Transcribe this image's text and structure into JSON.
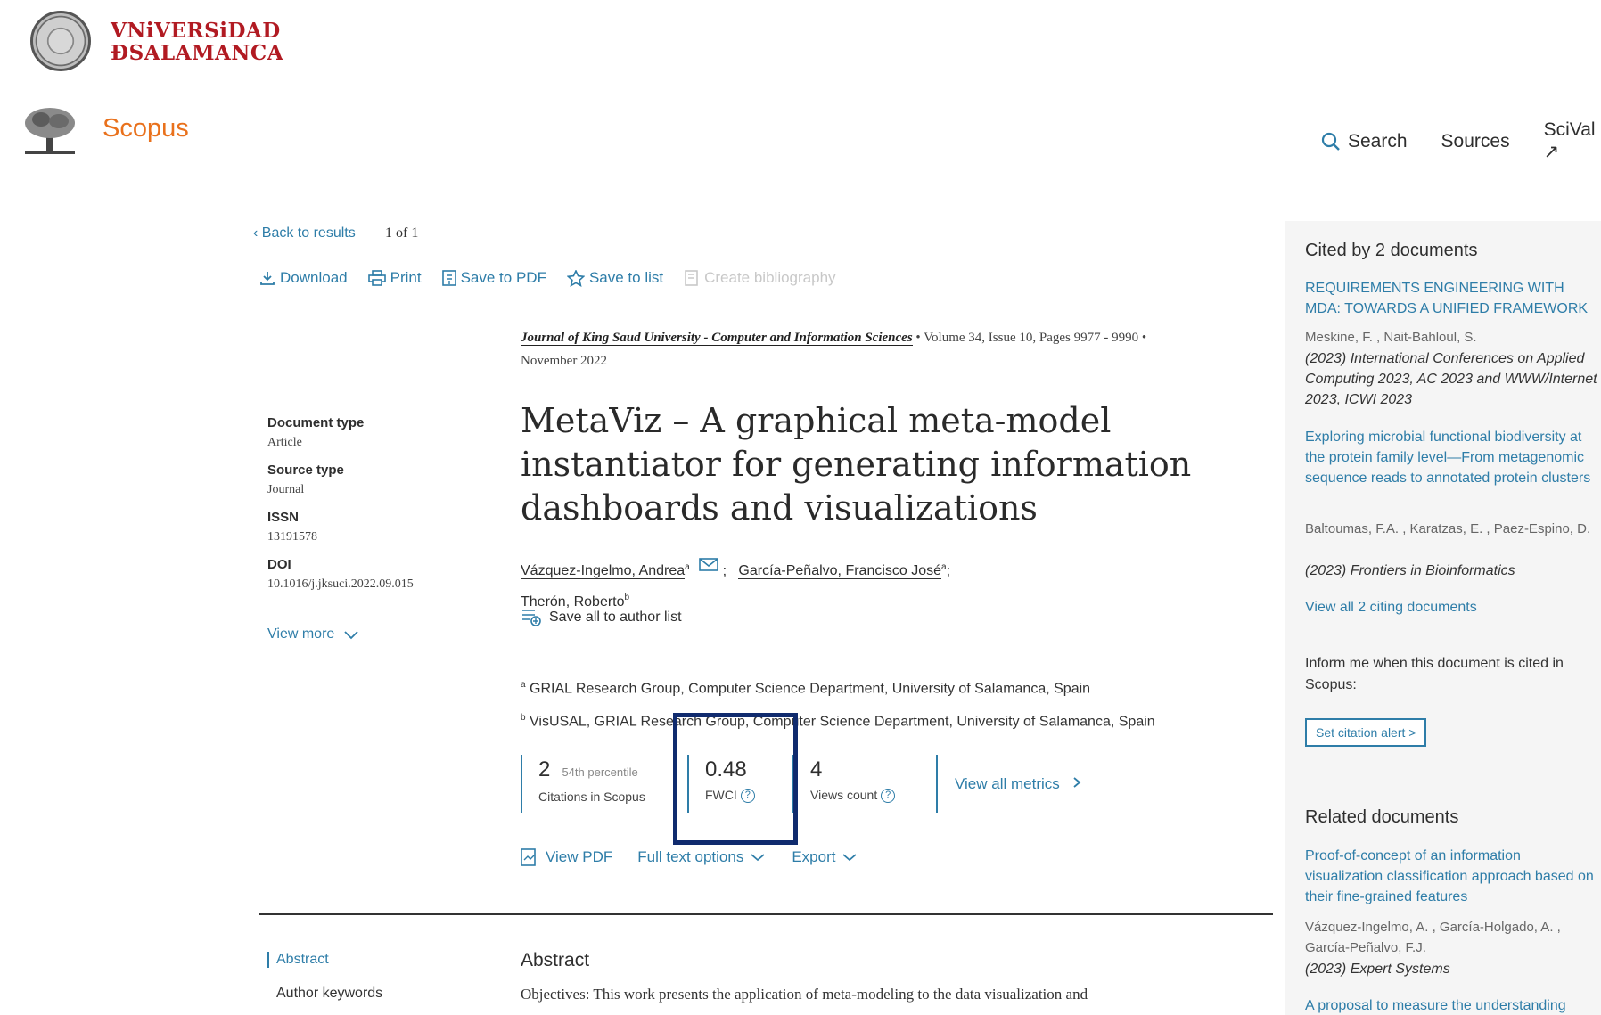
{
  "university": {
    "name_line1": "VNiVERSiDAD",
    "name_line2": "ÐSALAMANCA"
  },
  "header": {
    "logo_text": "Scopus",
    "nav": [
      "Search",
      "Sources",
      "SciVal ↗"
    ]
  },
  "toolbar": {
    "back": "Back to results",
    "page_of": "1  of  1",
    "tools": [
      "Download",
      "Print",
      "Save to PDF",
      "Save to list",
      "Create bibliography"
    ]
  },
  "meta": {
    "doc_type_label": "Document type",
    "doc_type": "Article",
    "source_type_label": "Source type",
    "source_type": "Journal",
    "issn_label": "ISSN",
    "issn": "13191578",
    "doi_label": "DOI",
    "doi": "10.1016/j.jksuci.2022.09.015",
    "view_more": "View more"
  },
  "article": {
    "journal": "Journal of King Saud University - Computer and Information Sciences",
    "volume": "Volume 34, Issue 10, Pages 9977 - 9990",
    "date": "November 2022",
    "title": "MetaViz – A graphical meta-model instantiator for generating information dashboards and visualizations",
    "authors": [
      {
        "name": "Vázquez-Ingelmo, Andrea",
        "sup": "a"
      },
      {
        "name": "García-Peñalvo, Francisco José",
        "sup": "a"
      },
      {
        "name": "Therón, Roberto",
        "sup": "b"
      }
    ],
    "save_authors": "Save all to author list",
    "affiliations": [
      {
        "sup": "a",
        "text": "GRIAL Research Group, Computer Science Department, University of Salamanca, Spain"
      },
      {
        "sup": "b",
        "text": "VisUSAL, GRIAL Research Group, Computer Science Department, University of Salamanca, Spain"
      }
    ]
  },
  "metrics": {
    "citations": "2",
    "percentile": "54th percentile",
    "citations_label": "Citations in Scopus",
    "fwci": "0.48",
    "fwci_label": "FWCI",
    "views": "4",
    "views_label": "Views count",
    "view_all": "View all metrics"
  },
  "actions": {
    "view_pdf": "View PDF",
    "full_text": "Full text options",
    "export": "Export"
  },
  "abstract": {
    "nav_abstract": "Abstract",
    "nav_keywords": "Author keywords",
    "heading": "Abstract",
    "text": "Objectives: This work presents the application of meta-modeling to the data visualization and"
  },
  "cited_by": {
    "heading": "Cited by 2 documents",
    "items": [
      {
        "title": "REQUIREMENTS ENGINEERING WITH MDA: TOWARDS A UNIFIED FRAMEWORK",
        "authors": "Meskine, F. , Nait-Bahloul, S.",
        "source": "(2023) International Conferences on Applied Computing 2023, AC 2023 and WWW/Internet 2023, ICWI 2023"
      },
      {
        "title": "Exploring microbial functional biodiversity at the protein family level—From metagenomic sequence reads to annotated protein clusters",
        "authors": "Baltoumas, F.A. , Karatzas, E. , Paez-Espino, D.",
        "source": "(2023) Frontiers in Bioinformatics"
      }
    ],
    "view_all": "View all 2 citing documents",
    "inform": "Inform me when this document is cited in Scopus:",
    "alert_btn": "Set citation alert >"
  },
  "related": {
    "heading": "Related documents",
    "items": [
      {
        "title": "Proof-of-concept of an information visualization classification approach based on their fine-grained features",
        "authors": "Vázquez-Ingelmo, A. , García-Holgado, A. , García-Peñalvo, F.J.",
        "source": "(2023) Expert Systems"
      },
      {
        "title": "A proposal to measure the understanding",
        "authors": "",
        "source": ""
      }
    ]
  }
}
